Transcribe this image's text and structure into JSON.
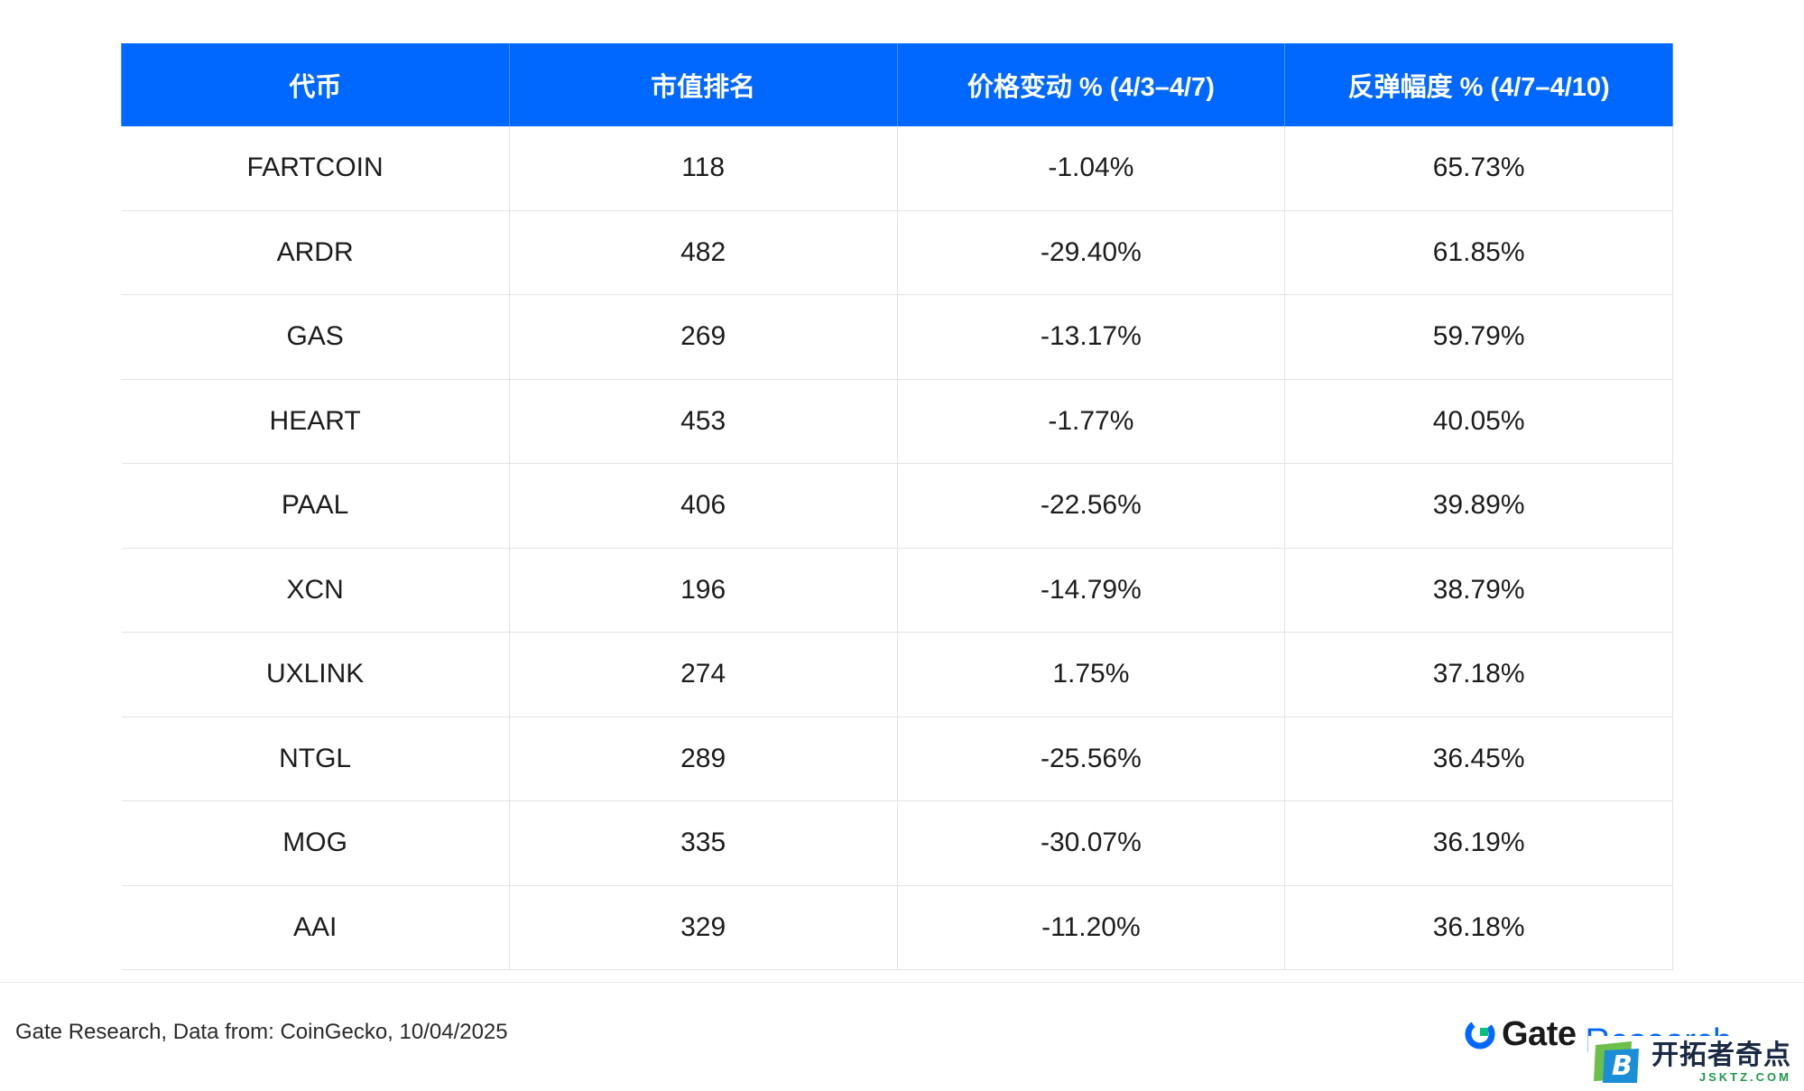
{
  "chart_data": {
    "type": "table",
    "columns": [
      "代币",
      "市值排名",
      "价格变动 % (4/3–4/7)",
      "反弹幅度 % (4/7–4/10)"
    ],
    "rows": [
      [
        "FARTCOIN",
        "118",
        "-1.04%",
        "65.73%"
      ],
      [
        "ARDR",
        "482",
        "-29.40%",
        "61.85%"
      ],
      [
        "GAS",
        "269",
        "-13.17%",
        "59.79%"
      ],
      [
        "HEART",
        "453",
        "-1.77%",
        "40.05%"
      ],
      [
        "PAAL",
        "406",
        "-22.56%",
        "39.89%"
      ],
      [
        "XCN",
        "196",
        "-14.79%",
        "38.79%"
      ],
      [
        "UXLINK",
        "274",
        "1.75%",
        "37.18%"
      ],
      [
        "NTGL",
        "289",
        "-25.56%",
        "36.45%"
      ],
      [
        "MOG",
        "335",
        "-30.07%",
        "36.19%"
      ],
      [
        "AAI",
        "329",
        "-11.20%",
        "36.18%"
      ]
    ],
    "header_color": "#0068ff"
  },
  "footer": {
    "source": "Gate Research, Data from: CoinGecko, 10/04/2025"
  },
  "brand": {
    "name": "Gate",
    "suffix": "Research",
    "accent": "#0068ff"
  },
  "watermark": {
    "badge": "B",
    "title": "开拓者奇点",
    "domain": "JSKTZ.COM"
  }
}
